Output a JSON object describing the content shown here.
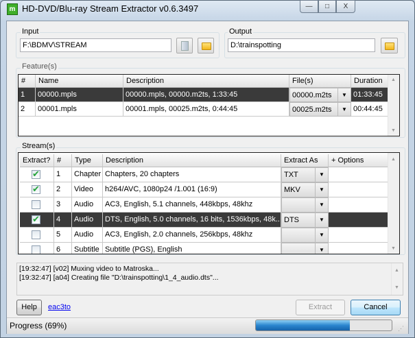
{
  "window": {
    "title": "HD-DVD/Blu-ray Stream Extractor v0.6.3497",
    "min": "—",
    "max": "□",
    "close": "X"
  },
  "input": {
    "label": "Input",
    "value": "F:\\BDMV\\STREAM"
  },
  "output": {
    "label": "Output",
    "value": "D:\\trainspotting"
  },
  "features": {
    "label": "Feature(s)",
    "headers": [
      "#",
      "Name",
      "Description",
      "File(s)",
      "Duration"
    ],
    "rows": [
      {
        "num": "1",
        "name": "00000.mpls",
        "desc": "00000.mpls, 00000.m2ts, 1:33:45",
        "file": "00000.m2ts",
        "duration": "01:33:45",
        "selected": true
      },
      {
        "num": "2",
        "name": "00001.mpls",
        "desc": "00001.mpls, 00025.m2ts, 0:44:45",
        "file": "00025.m2ts",
        "duration": "00:44:45",
        "selected": false
      }
    ]
  },
  "streams": {
    "label": "Stream(s)",
    "headers": [
      "Extract?",
      "#",
      "Type",
      "Description",
      "Extract As",
      "+ Options"
    ],
    "rows": [
      {
        "checked": true,
        "num": "1",
        "type": "Chapter",
        "desc": "Chapters, 20 chapters",
        "as": "TXT"
      },
      {
        "checked": true,
        "num": "2",
        "type": "Video",
        "desc": "h264/AVC, 1080p24 /1.001 (16:9)",
        "as": "MKV"
      },
      {
        "checked": false,
        "num": "3",
        "type": "Audio",
        "desc": "AC3, English, 5.1 channels, 448kbps, 48khz",
        "as": ""
      },
      {
        "checked": true,
        "num": "4",
        "type": "Audio",
        "desc": "DTS, English, 5.0 channels, 16 bits, 1536kbps, 48k...",
        "as": "DTS",
        "selected": true
      },
      {
        "checked": false,
        "num": "5",
        "type": "Audio",
        "desc": "AC3, English, 2.0 channels, 256kbps, 48khz",
        "as": ""
      },
      {
        "checked": false,
        "num": "6",
        "type": "Subtitle",
        "desc": "Subtitle (PGS), English",
        "as": ""
      }
    ]
  },
  "log": [
    "[19:32:47] [v02] Muxing video to Matroska...",
    "[19:32:47] [a04] Creating file \"D:\\trainspotting\\1_4_audio.dts\"..."
  ],
  "buttons": {
    "help": "Help",
    "link": "eac3to",
    "extract": "Extract",
    "cancel": "Cancel"
  },
  "status": {
    "text": "Progress (69%)",
    "progress": 69
  }
}
